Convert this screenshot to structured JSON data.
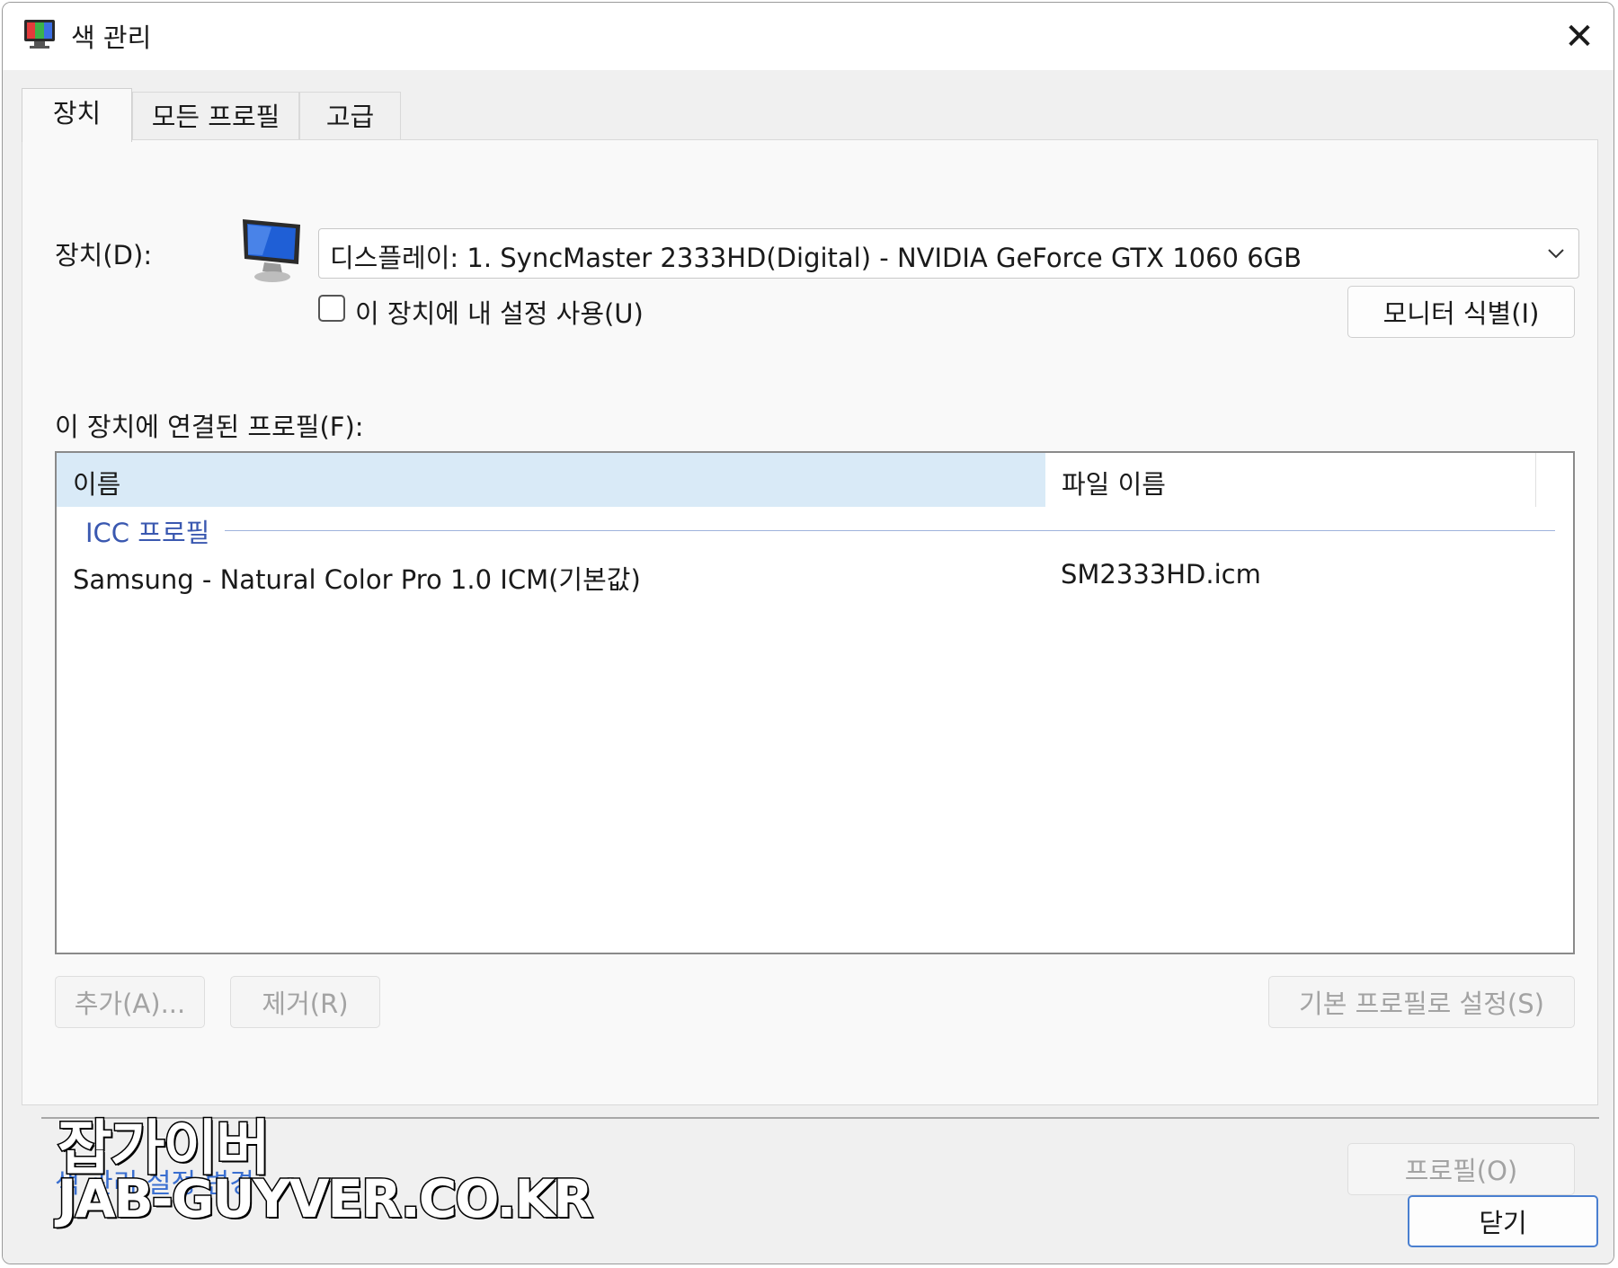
{
  "window": {
    "title": "색 관리",
    "close_glyph": "✕",
    "app_icon": "color-management-icon"
  },
  "tabs": [
    {
      "label": "장치",
      "active": true
    },
    {
      "label": "모든 프로필",
      "active": false
    },
    {
      "label": "고급",
      "active": false
    }
  ],
  "device": {
    "label": "장치(D):",
    "selected": "디스플레이: 1. SyncMaster 2333HD(Digital) - NVIDIA GeForce GTX 1060 6GB",
    "checkbox_label": "이 장치에 내 설정 사용(U)",
    "checkbox_checked": false,
    "identify_button": "모니터 식별(I)"
  },
  "profiles": {
    "label": "이 장치에 연결된 프로필(F):",
    "columns": [
      "이름",
      "파일 이름"
    ],
    "group": "ICC 프로필",
    "rows": [
      {
        "name": "Samsung - Natural Color Pro 1.0 ICM(기본값)",
        "file": "SM2333HD.icm"
      }
    ]
  },
  "buttons": {
    "add": "추가(A)...",
    "remove": "제거(R)",
    "set_default": "기본 프로필로 설정(S)",
    "profile": "프로필(O)",
    "close": "닫기"
  },
  "link_partial": "색 관리 설정 변경",
  "watermark": {
    "line1": "잡가이버",
    "line2": "JAB-GUYVER.CO.KR"
  },
  "colors": {
    "accent": "#4a7fd0",
    "header_selected": "#d9eaf7",
    "group_text": "#3a58b0"
  }
}
